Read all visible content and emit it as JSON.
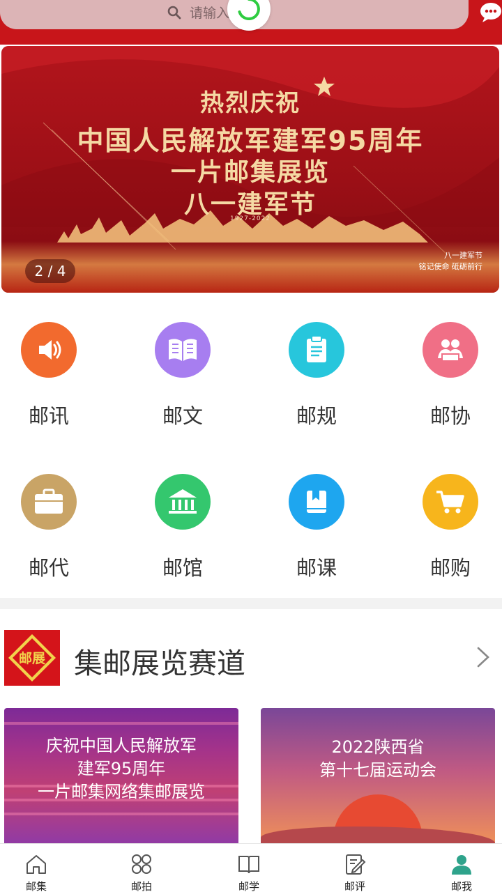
{
  "search": {
    "placeholder": "请输入内容"
  },
  "banner": {
    "line1": "热烈庆祝",
    "line2": "中国人民解放军建军95周年",
    "line3": "一片邮集展览",
    "line4": "八一建军节",
    "years": "1927-2022",
    "corner_line1": "八一建军节",
    "corner_line2": "铭记使命 砥砺前行",
    "pager": "2 / 4"
  },
  "shortcuts": [
    {
      "label": "邮讯",
      "icon": "speaker-icon",
      "color": "#f26a2e"
    },
    {
      "label": "邮文",
      "icon": "book-icon",
      "color": "#a77ef0"
    },
    {
      "label": "邮规",
      "icon": "clipboard-icon",
      "color": "#27c6dc"
    },
    {
      "label": "邮协",
      "icon": "people-icon",
      "color": "#f06f86"
    },
    {
      "label": "邮代",
      "icon": "briefcase-icon",
      "color": "#c9a466"
    },
    {
      "label": "邮馆",
      "icon": "museum-icon",
      "color": "#34c76e"
    },
    {
      "label": "邮课",
      "icon": "bookmark-icon",
      "color": "#1ea6ef"
    },
    {
      "label": "邮购",
      "icon": "cart-icon",
      "color": "#f7b51c"
    }
  ],
  "section": {
    "stamp_text": "邮展",
    "title": "集邮展览赛道"
  },
  "cards": [
    {
      "text": "庆祝中国人民解放军\n建军95周年\n一片邮集网络集邮展览"
    },
    {
      "text": "2022陕西省\n第十七届运动会"
    }
  ],
  "tabs": [
    {
      "label": "邮集",
      "icon": "home-icon"
    },
    {
      "label": "邮拍",
      "icon": "grid-icon"
    },
    {
      "label": "邮学",
      "icon": "open-book-icon"
    },
    {
      "label": "邮评",
      "icon": "edit-icon"
    },
    {
      "label": "邮我",
      "icon": "user-icon",
      "active": true
    }
  ],
  "colors": {
    "header_red": "#c8151a",
    "active_tab": "#2ea38b"
  }
}
